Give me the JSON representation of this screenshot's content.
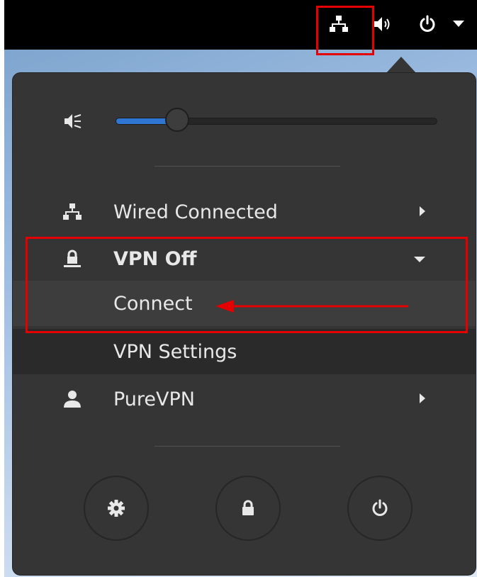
{
  "topbar": {
    "indicators": [
      {
        "icon": "network-wired-icon"
      },
      {
        "icon": "volume-icon"
      },
      {
        "icon": "power-icon"
      },
      {
        "icon": "dropdown-arrow-icon"
      }
    ]
  },
  "menu": {
    "volume": {
      "icon": "volume-muted-icon",
      "level_percent": 19
    },
    "items": {
      "wired": {
        "label": "Wired Connected",
        "icon": "network-wired-icon",
        "submenu": true
      },
      "vpn": {
        "label": "VPN Off",
        "icon": "vpn-icon",
        "expanded": true
      },
      "connect": {
        "label": "Connect"
      },
      "vpn_settings": {
        "label": "VPN Settings"
      },
      "purevpn": {
        "label": "PureVPN",
        "icon": "user-icon",
        "submenu": true
      }
    },
    "buttons": [
      {
        "icon": "gear-icon"
      },
      {
        "icon": "lock-icon"
      },
      {
        "icon": "power-icon"
      }
    ]
  },
  "colors": {
    "menu_bg": "#353535",
    "highlight": "#e40000",
    "slider_fill": "#2f76d2",
    "text": "#e8e8e8"
  }
}
